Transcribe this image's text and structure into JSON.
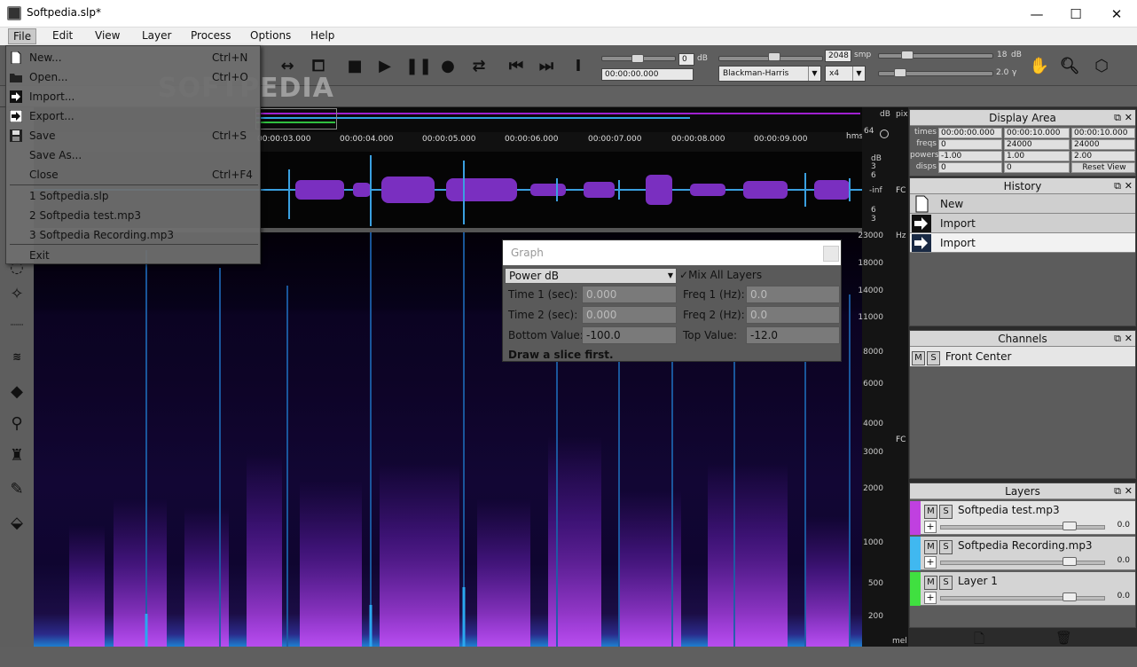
{
  "window": {
    "title": "Softpedia.slp*",
    "min_glyph": "—",
    "max_glyph": "☐",
    "close_glyph": "✕"
  },
  "menubar": [
    "File",
    "Edit",
    "View",
    "Layer",
    "Process",
    "Options",
    "Help"
  ],
  "file_menu": {
    "items": [
      {
        "label": "New...",
        "shortcut": "Ctrl+N",
        "icon": "new-file-icon"
      },
      {
        "label": "Open...",
        "shortcut": "Ctrl+O",
        "icon": "open-folder-icon"
      },
      {
        "label": "Import...",
        "shortcut": "",
        "icon": "import-icon"
      },
      {
        "label": "Export...",
        "shortcut": "",
        "icon": "export-icon"
      },
      {
        "label": "Save",
        "shortcut": "Ctrl+S",
        "icon": "save-icon"
      },
      {
        "label": "Save As...",
        "shortcut": "",
        "icon": ""
      },
      {
        "label": "Close",
        "shortcut": "Ctrl+F4",
        "icon": ""
      }
    ],
    "recent": [
      "1 Softpedia.slp",
      "2 Softpedia test.mp3",
      "3 Softpedia Recording.mp3"
    ],
    "exit": "Exit"
  },
  "watermark": "SOFTPEDIA",
  "toolbar": {
    "gain_value": "0",
    "gain_unit": "dB",
    "time_value": "00:00:00.000",
    "fft_size": "2048",
    "fft_unit": "smp",
    "window_fn": "Blackman-Harris",
    "oversample": "x4",
    "range_value": "18",
    "range_unit": "dB",
    "gamma_value": "2.0",
    "gamma_unit": "γ"
  },
  "ruler": {
    "ticks": [
      "00:00:03.000",
      "00:00:04.000",
      "00:00:05.000",
      "00:00:06.000",
      "00:00:07.000",
      "00:00:08.000",
      "00:00:09.000"
    ],
    "unit": "hms"
  },
  "waveform_scale": {
    "unit": "dB",
    "ticks": [
      "3",
      "6",
      "-inf",
      "6",
      "3"
    ],
    "fc": "FC"
  },
  "overview_scale": {
    "left": "dB",
    "right": "pix",
    "top": "64"
  },
  "freq_scale": {
    "unit": "Hz",
    "ticks": [
      "23000",
      "18000",
      "14000",
      "11000",
      "8000",
      "6000",
      "4000",
      "3000",
      "2000",
      "1000",
      "500",
      "200"
    ],
    "bottom": "mel",
    "fc": "FC"
  },
  "display_area": {
    "title": "Display Area",
    "rows": [
      {
        "label": "times",
        "cells": [
          "00:00:00.000",
          "00:00:10.000",
          "00:00:10.000"
        ]
      },
      {
        "label": "freqs",
        "cells": [
          "0",
          "24000",
          "24000"
        ]
      },
      {
        "label": "powers",
        "cells": [
          "-1.00",
          "1.00",
          "2.00"
        ]
      },
      {
        "label": "disps",
        "cells": [
          "0",
          "0"
        ]
      }
    ],
    "reset_label": "Reset View"
  },
  "history": {
    "title": "History",
    "items": [
      {
        "label": "New",
        "icon": "new-file-icon"
      },
      {
        "label": "Import",
        "icon": "import-icon"
      },
      {
        "label": "Import",
        "icon": "import-icon"
      }
    ]
  },
  "channels": {
    "title": "Channels",
    "items": [
      {
        "m": "M",
        "s": "S",
        "label": "Front Center"
      }
    ]
  },
  "layers": {
    "title": "Layers",
    "items": [
      {
        "name": "Softpedia test.mp3",
        "color": "#c040e0",
        "m": "M",
        "s": "S",
        "plus": "+",
        "value": "0.0"
      },
      {
        "name": "Softpedia Recording.mp3",
        "color": "#40b8f0",
        "m": "M",
        "s": "S",
        "plus": "+",
        "value": "0.0"
      },
      {
        "name": "Layer 1",
        "color": "#40e040",
        "m": "M",
        "s": "S",
        "plus": "+",
        "value": "0.0"
      }
    ]
  },
  "graph_dialog": {
    "title": "Graph",
    "mode": "Power dB",
    "mix_all": "Mix All Layers",
    "time1_label": "Time 1 (sec):",
    "time1_value": "0.000",
    "freq1_label": "Freq 1 (Hz):",
    "freq1_value": "0.0",
    "time2_label": "Time 2 (sec):",
    "time2_value": "0.000",
    "freq2_label": "Freq 2 (Hz):",
    "freq2_value": "0.0",
    "bottom_label": "Bottom Value:",
    "bottom_value": "-100.0",
    "top_label": "Top Value:",
    "top_value": "-12.0",
    "hint": "Draw a slice first."
  },
  "panel_controls": {
    "float": "⧉",
    "close": "✕"
  }
}
